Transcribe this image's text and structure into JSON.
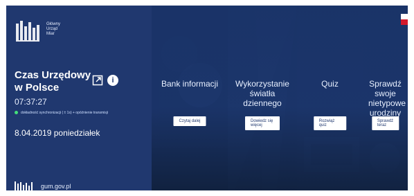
{
  "brand": {
    "logo_text_lines": [
      "Główny",
      "Urząd",
      "Miar"
    ]
  },
  "clock": {
    "title_line1": "Czas Urzędowy",
    "title_line2": "w Polsce",
    "time": "07:37:27",
    "sync_text": "dokładność synchronizacji ( ± 1s) + opóźnienie transmisji",
    "date": "8.04.2019  poniedziałek"
  },
  "footer": {
    "site": "gum.gov.pl"
  },
  "tiles": [
    {
      "heading": "Bank informacji",
      "button": "Czytaj dalej"
    },
    {
      "heading": "Wykorzystanie światła dziennego",
      "button": "Dowiedz się więcej"
    },
    {
      "heading": "Quiz",
      "button": "Rozwiąż quiz"
    },
    {
      "heading": "Sprawdź swoje nietypowe urodziny",
      "button": "Sprawdź teraz"
    }
  ],
  "colors": {
    "primary": "#20386f",
    "status_dot": "#44e07a",
    "flag_red": "#d31a2d"
  },
  "icons": {
    "popup": "external-window-icon",
    "info": "info-icon"
  }
}
